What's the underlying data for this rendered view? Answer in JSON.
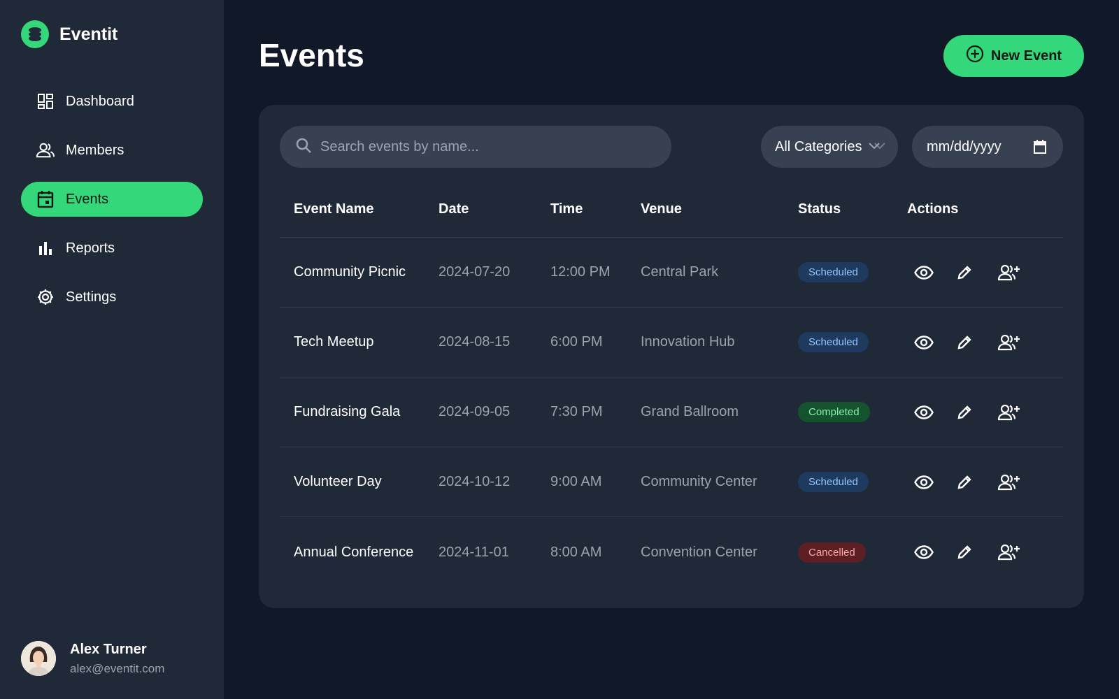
{
  "app": {
    "name": "Eventit",
    "accent": "#34d77a"
  },
  "sidebar": {
    "items": [
      {
        "label": "Dashboard",
        "icon": "dashboard-icon",
        "active": false
      },
      {
        "label": "Members",
        "icon": "members-icon",
        "active": false
      },
      {
        "label": "Events",
        "icon": "calendar-icon",
        "active": true
      },
      {
        "label": "Reports",
        "icon": "bar-chart-icon",
        "active": false
      },
      {
        "label": "Settings",
        "icon": "gear-icon",
        "active": false
      }
    ]
  },
  "user": {
    "name": "Alex Turner",
    "email": "alex@eventit.com"
  },
  "header": {
    "title": "Events",
    "new_button": "New Event"
  },
  "filters": {
    "search_placeholder": "Search events by name...",
    "category": "All Categories",
    "date_placeholder": "mm/dd/yyyy"
  },
  "table": {
    "columns": [
      "Event Name",
      "Date",
      "Time",
      "Venue",
      "Status",
      "Actions"
    ],
    "rows": [
      {
        "name": "Community Picnic",
        "date": "2024-07-20",
        "time": "12:00 PM",
        "venue": "Central Park",
        "status": "Scheduled"
      },
      {
        "name": "Tech Meetup",
        "date": "2024-08-15",
        "time": "6:00 PM",
        "venue": "Innovation Hub",
        "status": "Scheduled"
      },
      {
        "name": "Fundraising Gala",
        "date": "2024-09-05",
        "time": "7:30 PM",
        "venue": "Grand Ballroom",
        "status": "Completed"
      },
      {
        "name": "Volunteer Day",
        "date": "2024-10-12",
        "time": "9:00 AM",
        "venue": "Community Center",
        "status": "Scheduled"
      },
      {
        "name": "Annual Conference",
        "date": "2024-11-01",
        "time": "8:00 AM",
        "venue": "Convention Center",
        "status": "Cancelled"
      }
    ],
    "actions": [
      "view-icon",
      "edit-icon",
      "add-attendee-icon"
    ]
  },
  "status_colors": {
    "Scheduled": "#93c5fd",
    "Completed": "#86efac",
    "Cancelled": "#fca5a5"
  }
}
